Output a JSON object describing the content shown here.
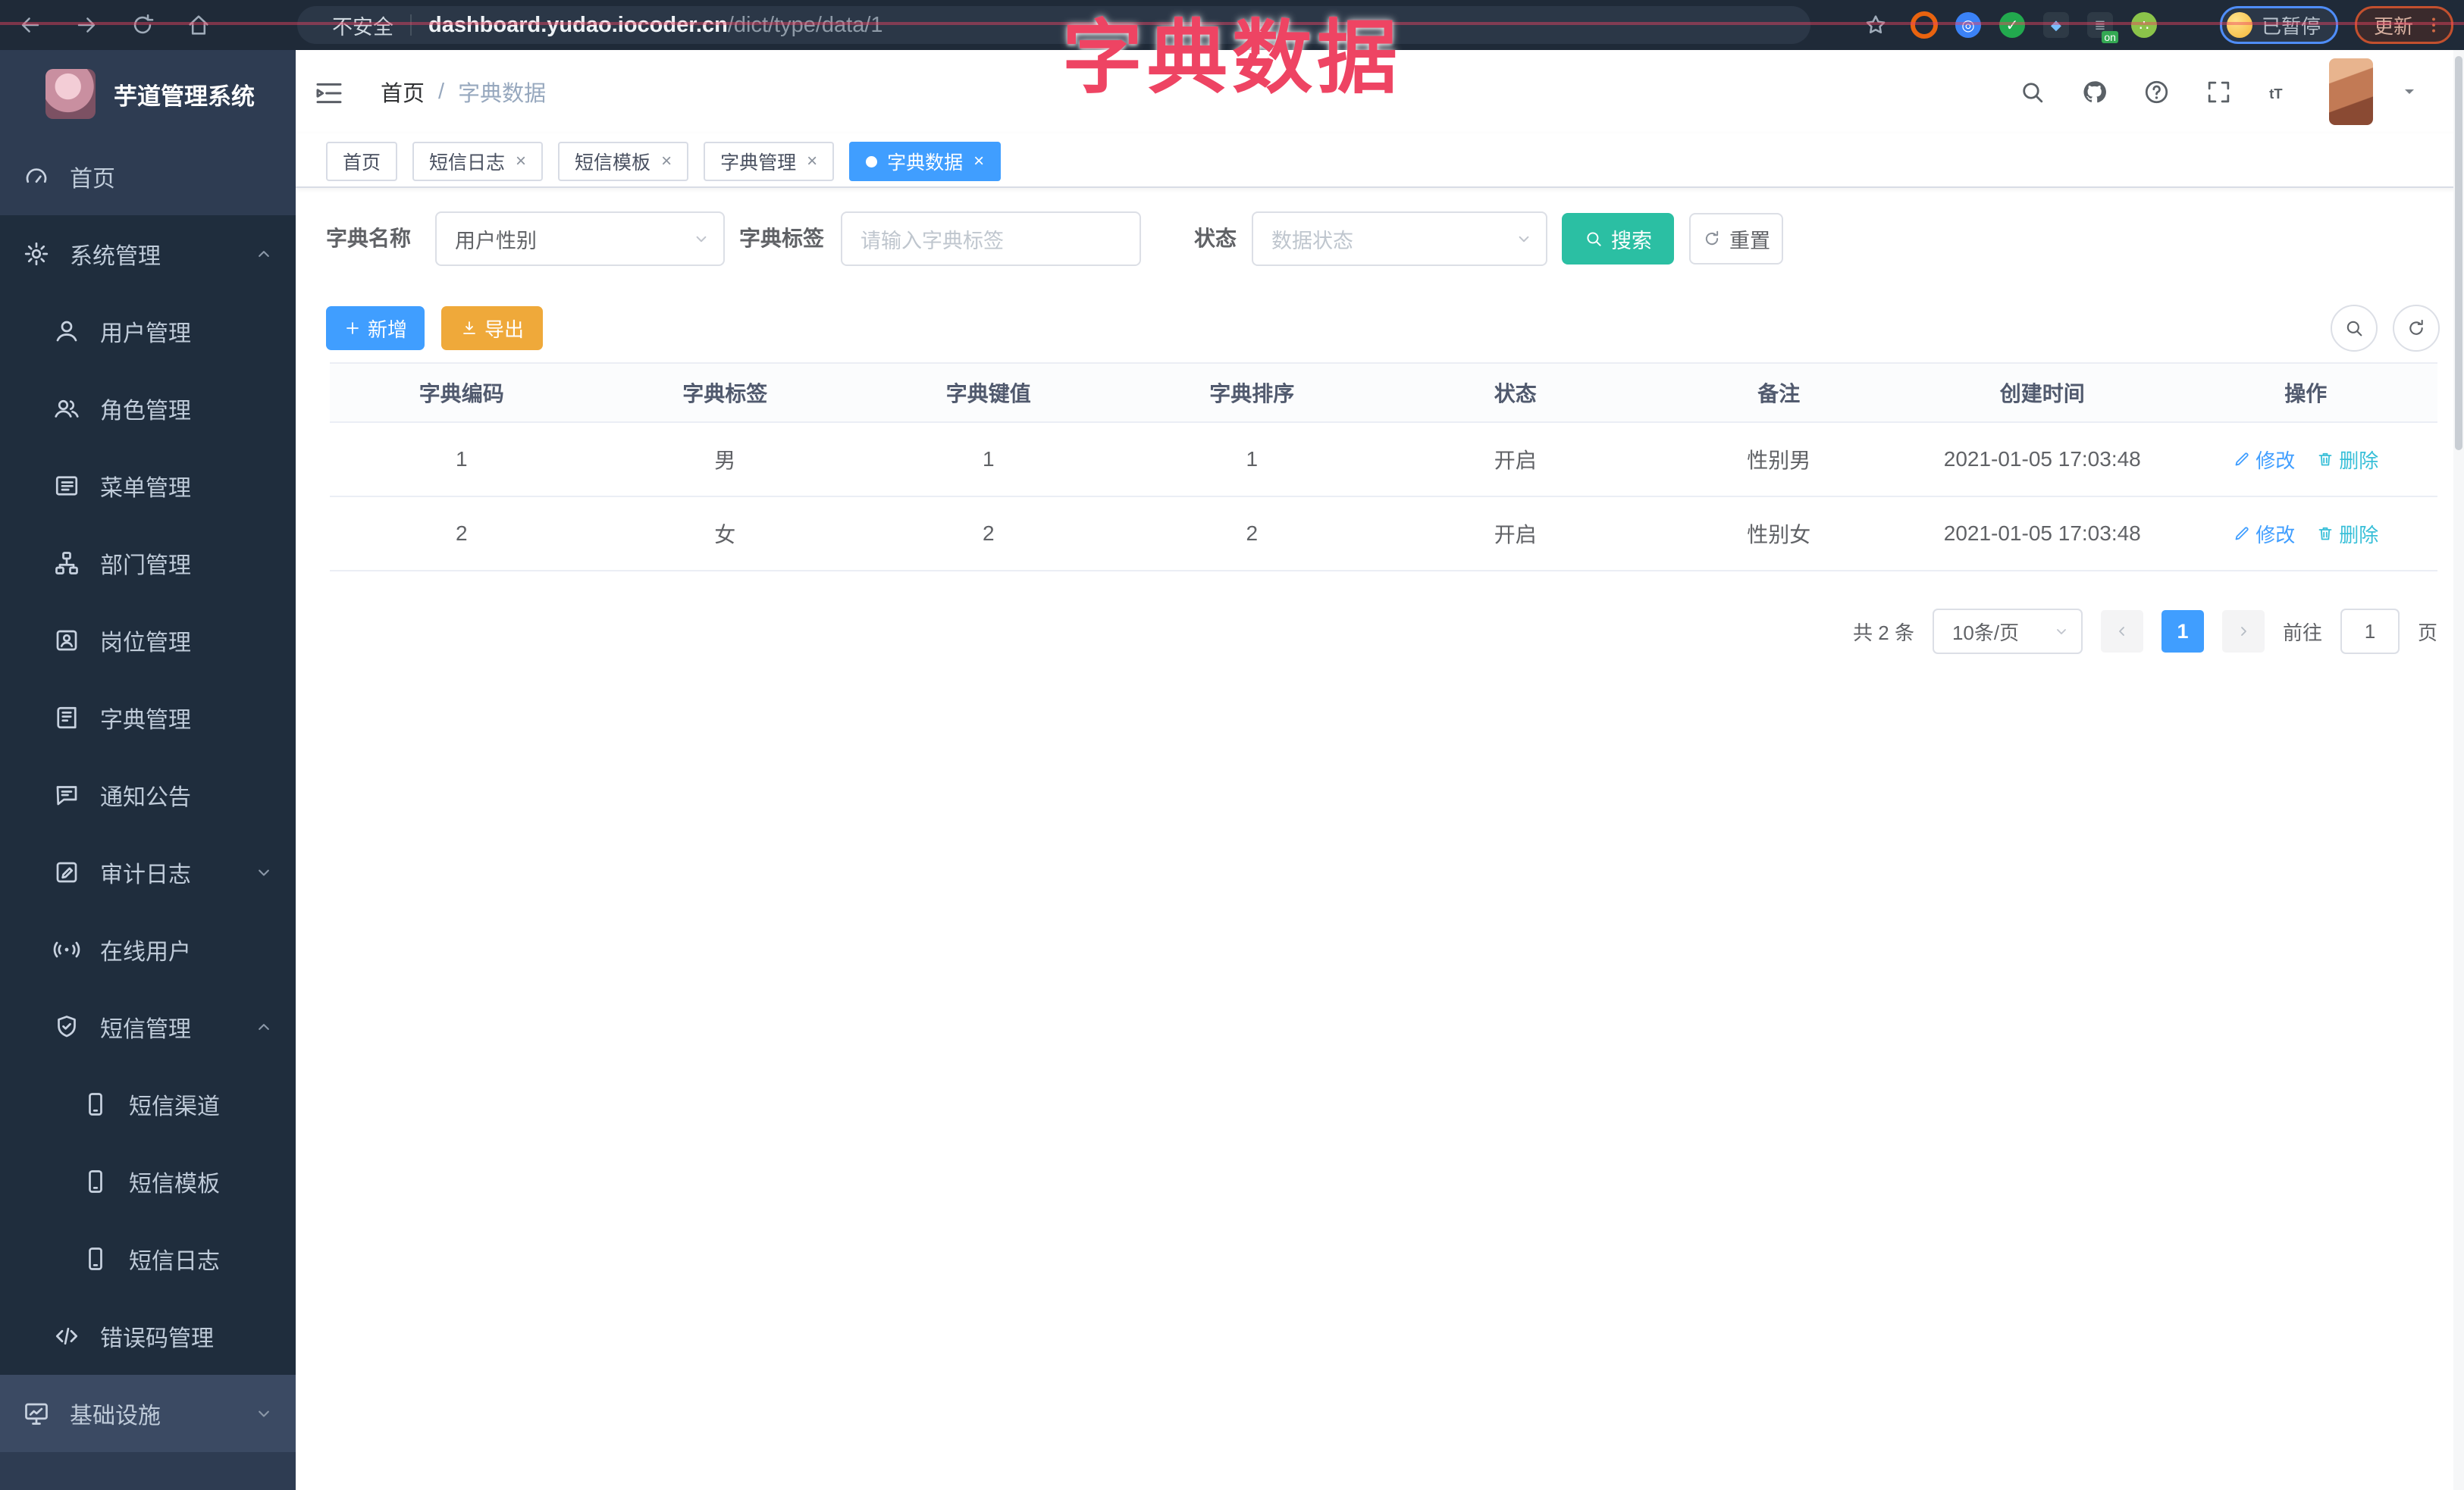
{
  "chrome": {
    "security_text": "不安全",
    "url_host": "dashboard.yudao.iocoder.cn",
    "url_path": "/dict/type/data/1",
    "paused_badge": "已暂停",
    "update_button": "更新",
    "nav_icons": [
      "back",
      "forward",
      "reload",
      "home"
    ],
    "extension_icons": [
      "orange-ring",
      "blue-drop",
      "green-check",
      "teal-bars",
      "on-badge",
      "green-grid",
      "puzzle"
    ]
  },
  "overlay": {
    "title": "字典数据",
    "color": "#ee4463"
  },
  "sidebar": {
    "app_title": "芋道管理系统",
    "items": [
      {
        "label": "首页",
        "icon": "gauge",
        "level": 0,
        "zone": "top"
      },
      {
        "label": "系统管理",
        "icon": "gear",
        "level": 0,
        "zone": "dark",
        "chevron": "up"
      },
      {
        "label": "用户管理",
        "icon": "user",
        "level": 1,
        "zone": "dark"
      },
      {
        "label": "角色管理",
        "icon": "users",
        "level": 1,
        "zone": "dark"
      },
      {
        "label": "菜单管理",
        "icon": "list",
        "level": 1,
        "zone": "dark"
      },
      {
        "label": "部门管理",
        "icon": "tree",
        "level": 1,
        "zone": "dark"
      },
      {
        "label": "岗位管理",
        "icon": "badge",
        "level": 1,
        "zone": "dark"
      },
      {
        "label": "字典管理",
        "icon": "book",
        "level": 1,
        "zone": "dark"
      },
      {
        "label": "通知公告",
        "icon": "chat",
        "level": 1,
        "zone": "dark"
      },
      {
        "label": "审计日志",
        "icon": "log",
        "level": 1,
        "zone": "dark",
        "chevron": "down"
      },
      {
        "label": "在线用户",
        "icon": "online",
        "level": 1,
        "zone": "dark"
      },
      {
        "label": "短信管理",
        "icon": "shield",
        "level": 1,
        "zone": "dark",
        "chevron": "up"
      },
      {
        "label": "短信渠道",
        "icon": "phone",
        "level": 2,
        "zone": "dark"
      },
      {
        "label": "短信模板",
        "icon": "phone",
        "level": 2,
        "zone": "dark"
      },
      {
        "label": "短信日志",
        "icon": "phone",
        "level": 2,
        "zone": "dark"
      },
      {
        "label": "错误码管理",
        "icon": "code",
        "level": 1,
        "zone": "dark"
      },
      {
        "label": "基础设施",
        "icon": "monitor",
        "level": 0,
        "zone": "light",
        "chevron": "down"
      }
    ]
  },
  "navbar": {
    "breadcrumb": [
      "首页",
      "字典数据"
    ],
    "separator": "/",
    "icons": [
      "search",
      "github",
      "question",
      "fullscreen",
      "fontsize"
    ]
  },
  "tabs": [
    {
      "label": "首页",
      "closable": false,
      "active": false
    },
    {
      "label": "短信日志",
      "closable": true,
      "active": false
    },
    {
      "label": "短信模板",
      "closable": true,
      "active": false
    },
    {
      "label": "字典管理",
      "closable": true,
      "active": false
    },
    {
      "label": "字典数据",
      "closable": true,
      "active": true
    }
  ],
  "filters": {
    "name_label": "字典名称",
    "name_value": "用户性别",
    "label_label": "字典标签",
    "label_placeholder": "请输入字典标签",
    "status_label": "状态",
    "status_placeholder": "数据状态",
    "search_button": "搜索",
    "reset_button": "重置"
  },
  "toolbar": {
    "add_button": "新增",
    "export_button": "导出"
  },
  "table": {
    "columns": [
      "字典编码",
      "字典标签",
      "字典键值",
      "字典排序",
      "状态",
      "备注",
      "创建时间",
      "操作"
    ],
    "rows": [
      {
        "cells": [
          "1",
          "男",
          "1",
          "1",
          "开启",
          "性别男",
          "2021-01-05 17:03:48"
        ]
      },
      {
        "cells": [
          "2",
          "女",
          "2",
          "2",
          "开启",
          "性别女",
          "2021-01-05 17:03:48"
        ]
      }
    ],
    "edit_label": "修改",
    "delete_label": "删除"
  },
  "pagination": {
    "total_text": "共 2 条",
    "page_size": "10条/页",
    "current_page": "1",
    "goto_label": "前往",
    "goto_value": "1",
    "page_label": "页"
  },
  "colors": {
    "accent_blue": "#409eff",
    "search_teal": "#2bbfa3",
    "export_orange": "#efa93a",
    "overlay_red": "#ee4463",
    "sidebar_bg": "#2e3c52",
    "sidebar_submenu_bg": "#1f2d3d",
    "delete_link": "#38bfd8"
  }
}
